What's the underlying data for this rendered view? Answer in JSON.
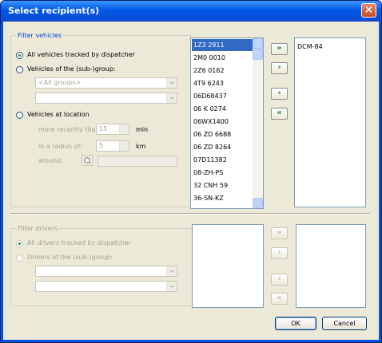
{
  "window": {
    "title": "Select recipient(s)",
    "close_glyph": "✕"
  },
  "vehicles": {
    "legend": "Filter vehicles",
    "opt_all": "All vehicles tracked by dispatcher",
    "opt_group": "Vehicles of the (sub-)group:",
    "group_combo": "<All groups>",
    "group_combo2": "",
    "opt_location": "Vehicles at location",
    "recent_label": "more recently than:",
    "recent_value": "15",
    "recent_unit": "min",
    "radius_label": "in a radius of:",
    "radius_value": "5",
    "radius_unit": "km",
    "around_label": "around:",
    "list": [
      "1Z3 2911",
      "2M0 0010",
      "2Z6 0162",
      "4T9 6243",
      "06D68437",
      "06 K 0274",
      "06WX1400",
      "06 ZD 6688",
      "06 ZD 8264",
      "07D11382",
      "08-ZH-PS",
      "32 CNH 59",
      "36-SN-KZ"
    ],
    "selected": [
      "DCM-84"
    ]
  },
  "drivers": {
    "legend": "Filter drivers",
    "opt_all": "All drivers tracked by dispatcher",
    "opt_group": "Drivers of the (sub-)group:"
  },
  "move_buttons": {
    "add_all": "»",
    "add": "›",
    "remove": "‹",
    "remove_all": "«"
  },
  "footer": {
    "ok": "OK",
    "cancel": "Cancel"
  }
}
